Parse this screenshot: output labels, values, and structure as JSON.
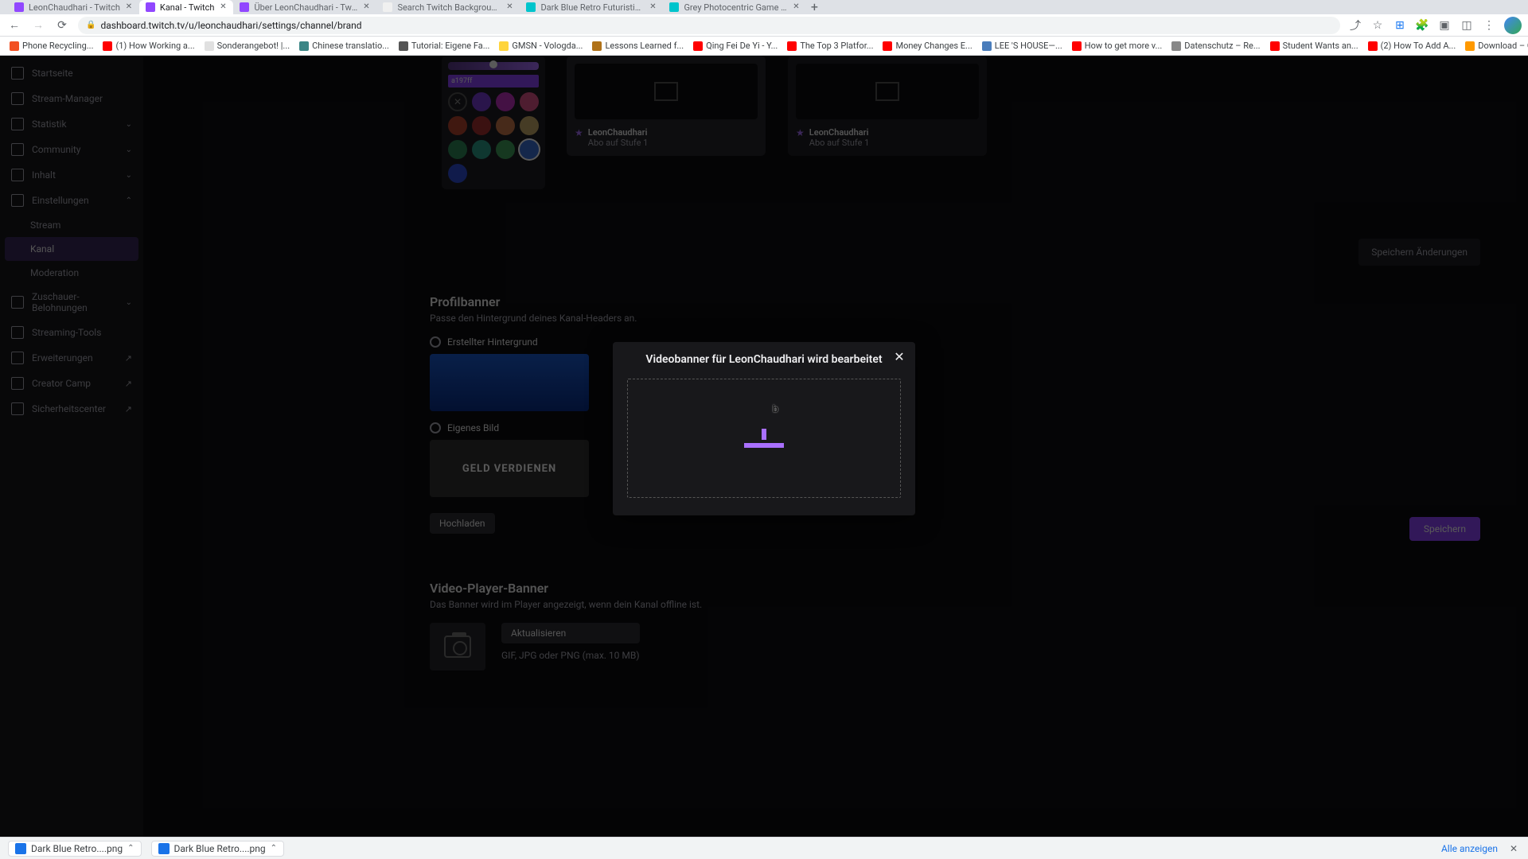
{
  "tabs": [
    {
      "title": "LeonChaudhari - Twitch",
      "favicon": "#9147ff"
    },
    {
      "title": "Kanal - Twitch",
      "favicon": "#9147ff"
    },
    {
      "title": "Über LeonChaudhari - Twitch",
      "favicon": "#9147ff"
    },
    {
      "title": "Search Twitch Background - C",
      "favicon": "#f0f0f0"
    },
    {
      "title": "Dark Blue Retro Futuristic Stre",
      "favicon": "#00c4cc"
    },
    {
      "title": "Grey Photocentric Game Nigh",
      "favicon": "#00c4cc"
    }
  ],
  "active_tab": 1,
  "url": "dashboard.twitch.tv/u/leonchaudhari/settings/channel/brand",
  "bookmarks": [
    {
      "label": "Phone Recycling...",
      "color": "#f25022"
    },
    {
      "label": "(1) How Working a...",
      "color": "#ff0000"
    },
    {
      "label": "Sonderangebot! |...",
      "color": "#e0e0e0"
    },
    {
      "label": "Chinese translatio...",
      "color": "#3b8686"
    },
    {
      "label": "Tutorial: Eigene Fa...",
      "color": "#555"
    },
    {
      "label": "GMSN - Vologda...",
      "color": "#ffd43b"
    },
    {
      "label": "Lessons Learned f...",
      "color": "#b07219"
    },
    {
      "label": "Qing Fei De Yi - Y...",
      "color": "#ff0000"
    },
    {
      "label": "The Top 3 Platfor...",
      "color": "#ff0000"
    },
    {
      "label": "Money Changes E...",
      "color": "#ff0000"
    },
    {
      "label": "LEE 'S HOUSE—...",
      "color": "#4a7dbb"
    },
    {
      "label": "How to get more v...",
      "color": "#ff0000"
    },
    {
      "label": "Datenschutz – Re...",
      "color": "#888"
    },
    {
      "label": "Student Wants an...",
      "color": "#ff0000"
    },
    {
      "label": "(2) How To Add A...",
      "color": "#ff0000"
    },
    {
      "label": "Download – Cooki...",
      "color": "#ff9900"
    }
  ],
  "sidenav": {
    "items": [
      {
        "label": "Startseite"
      },
      {
        "label": "Stream-Manager"
      },
      {
        "label": "Statistik",
        "caret": true
      },
      {
        "label": "Community",
        "caret": true
      },
      {
        "label": "Inhalt",
        "caret": true
      },
      {
        "label": "Einstellungen",
        "caret": true,
        "open": true
      },
      {
        "label": "Zuschauer-Belohnungen",
        "caret": true
      },
      {
        "label": "Streaming-Tools"
      },
      {
        "label": "Erweiterungen",
        "ext": true
      },
      {
        "label": "Creator Camp",
        "ext": true
      },
      {
        "label": "Sicherheitscenter",
        "ext": true
      }
    ],
    "subitems": {
      "stream": "Stream",
      "kanal": "Kanal",
      "moderation": "Moderation"
    }
  },
  "color_panel": {
    "accent_label": "a197ff"
  },
  "swatches": [
    "none",
    "#7a3dd8",
    "#c233c2",
    "#e0558a",
    "#b7452f",
    "#a93232",
    "#cc7a4a",
    "#c9ad6a",
    "#2f8a5b",
    "#2b9d8a",
    "#3fa05c",
    "#3a6fd8",
    "#2f4fd8"
  ],
  "swatch_selected": 11,
  "preview": {
    "name": "LeonChaudhari",
    "sub": "Abo auf Stufe 1"
  },
  "save_chip": "Speichern Änderungen",
  "profilbanner": {
    "heading": "Profilbanner",
    "sub": "Passe den Hintergrund deines Kanal-Headers an.",
    "opt1": "Erstellter Hintergrund",
    "opt2": "Eigenes Bild",
    "thumb_text": "GELD VERDIENEN",
    "upload": "Hochladen",
    "save": "Speichern"
  },
  "video_player_banner": {
    "heading": "Video-Player-Banner",
    "sub": "Das Banner wird im Player angezeigt, wenn dein Kanal offline ist.",
    "update": "Aktualisieren",
    "file_hint": "GIF, JPG oder PNG (max. 10 MB)"
  },
  "modal": {
    "title": "Videobanner für LeonChaudhari wird bearbeitet"
  },
  "downloads": {
    "item1": "Dark Blue Retro....png",
    "item2": "Dark Blue Retro....png",
    "show_all": "Alle anzeigen"
  }
}
